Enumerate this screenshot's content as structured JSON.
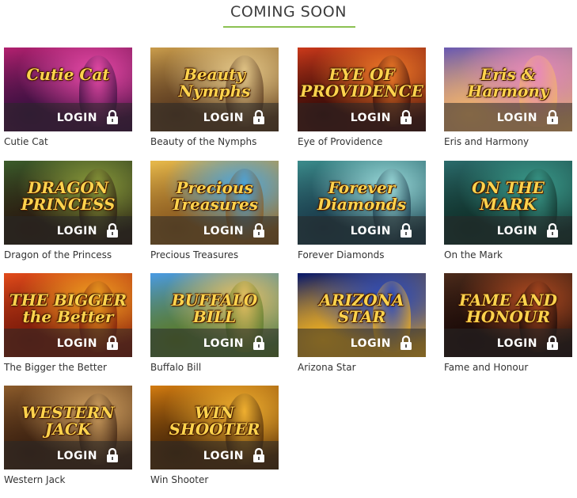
{
  "header": {
    "title": "COMING SOON"
  },
  "login_label": "LOGIN",
  "games": [
    {
      "name": "Cutie Cat",
      "art_title": "Cutie Cat",
      "palette": [
        "#b0206e",
        "#e84aa8",
        "#3a1040"
      ]
    },
    {
      "name": "Beauty of the Nymphs",
      "art_title": "Beauty Nymphs",
      "palette": [
        "#c79a4a",
        "#e6c98a",
        "#5a3a20"
      ]
    },
    {
      "name": "Eye of Providence",
      "art_title": "EYE OF PROVIDENCE",
      "palette": [
        "#c8381a",
        "#f07a28",
        "#3a0c08"
      ]
    },
    {
      "name": "Eris and Harmony",
      "art_title": "Eris & Harmony",
      "palette": [
        "#6b5ab0",
        "#e88ab8",
        "#f3b46a"
      ]
    },
    {
      "name": "Dragon of the Princess",
      "art_title": "DRAGON PRINCESS",
      "palette": [
        "#3a5a2a",
        "#8a9a3a",
        "#2a1a10"
      ]
    },
    {
      "name": "Precious Treasures",
      "art_title": "Precious Treasures",
      "palette": [
        "#e6b84a",
        "#4aa6e0",
        "#8a5a20"
      ]
    },
    {
      "name": "Forever Diamonds",
      "art_title": "Forever Diamonds",
      "palette": [
        "#3a8a8a",
        "#9adada",
        "#1a3a4a"
      ]
    },
    {
      "name": "On the Mark",
      "art_title": "ON THE MARK",
      "palette": [
        "#2a6a6a",
        "#3a9a8a",
        "#10302a"
      ]
    },
    {
      "name": "The Bigger the Better",
      "art_title": "THE BIGGER the Better",
      "palette": [
        "#e04a1a",
        "#f0a020",
        "#7a1a0a"
      ]
    },
    {
      "name": "Buffalo Bill",
      "art_title": "BUFFALO BILL",
      "palette": [
        "#4a9ae0",
        "#e8c060",
        "#5a7a2a"
      ]
    },
    {
      "name": "Arizona Star",
      "art_title": "ARIZONA STAR",
      "palette": [
        "#0a1a6a",
        "#2a4ac0",
        "#f0b020"
      ]
    },
    {
      "name": "Fame and Honour",
      "art_title": "FAME AND HONOUR",
      "palette": [
        "#4a2a1a",
        "#b04a20",
        "#1a0a08"
      ]
    },
    {
      "name": "Western Jack",
      "art_title": "WESTERN JACK",
      "palette": [
        "#8a5a2a",
        "#d0a060",
        "#3a2010"
      ]
    },
    {
      "name": "Win Shooter",
      "art_title": "WIN SHOOTER",
      "palette": [
        "#d07a10",
        "#f0b030",
        "#4a2808"
      ]
    }
  ],
  "colors": {
    "accent_underline": "#8cc152",
    "login_bar": "rgba(40,40,40,0.55)"
  },
  "icons": {
    "lock": "lock-icon"
  }
}
